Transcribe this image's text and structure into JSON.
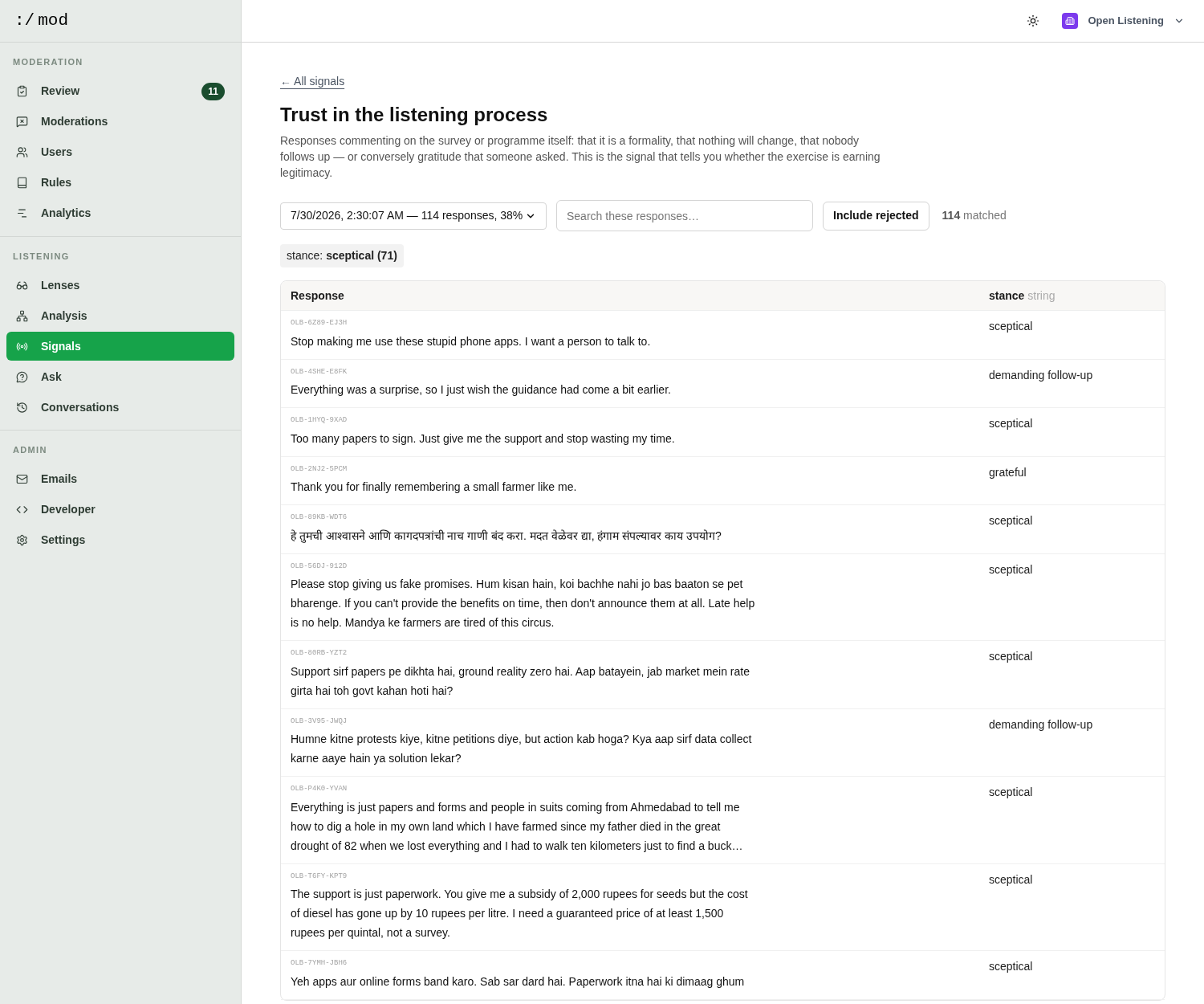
{
  "brand": {
    "mark": ":/",
    "name": "mod"
  },
  "sidebar": {
    "sections": [
      {
        "title": "MODERATION",
        "items": [
          {
            "label": "Review",
            "badge": "11",
            "selected": false
          },
          {
            "label": "Moderations",
            "selected": false
          },
          {
            "label": "Users",
            "selected": false
          },
          {
            "label": "Rules",
            "selected": false
          },
          {
            "label": "Analytics",
            "selected": false
          }
        ]
      },
      {
        "title": "LISTENING",
        "items": [
          {
            "label": "Lenses",
            "selected": false
          },
          {
            "label": "Analysis",
            "selected": false
          },
          {
            "label": "Signals",
            "selected": true
          },
          {
            "label": "Ask",
            "selected": false
          },
          {
            "label": "Conversations",
            "selected": false
          }
        ]
      },
      {
        "title": "ADMIN",
        "items": [
          {
            "label": "Emails",
            "selected": false
          },
          {
            "label": "Developer",
            "selected": false
          },
          {
            "label": "Settings",
            "selected": false
          }
        ]
      }
    ]
  },
  "topbar": {
    "workspace": "Open Listening"
  },
  "back_link": "← All signals",
  "title": "Trust in the listening process",
  "description": "Responses commenting on the survey or programme itself: that it is a formality, that nothing will change, that nobody follows up — or conversely gratitude that someone asked. This is the signal that tells you whether the exercise is earning legitimacy.",
  "filters": {
    "run_select": "7/30/2026, 2:30:07 AM — 114 responses, 38%",
    "search": {
      "placeholder": "Search these responses…"
    },
    "include_rejected": {
      "label": "Include rejected",
      "on": false
    },
    "matched_count": "114",
    "matched_label": "matched"
  },
  "active_filter": {
    "key": "stance:",
    "value": "sceptical (71)"
  },
  "table": {
    "columns": [
      {
        "label": "Response"
      },
      {
        "label": "stance",
        "type": "string"
      }
    ],
    "rows": [
      {
        "id": "OLB-6Z89-EJ3H",
        "text": "Stop making me use these stupid phone apps. I want a person to talk to.",
        "stance": "sceptical"
      },
      {
        "id": "OLB-4SHE-E8FK",
        "text": "Everything was a surprise, so I just wish the guidance had come a bit earlier.",
        "stance": "demanding follow-up"
      },
      {
        "id": "OLB-1HYQ-9XAD",
        "text": "Too many papers to sign. Just give me the support and stop wasting my time.",
        "stance": "sceptical"
      },
      {
        "id": "OLB-2NJ2-5PCM",
        "text": "Thank you for finally remembering a small farmer like me.",
        "stance": "grateful"
      },
      {
        "id": "OLB-89KB-WDT6",
        "text": "हे तुमची आश्वासने आणि कागदपत्रांची नाच गाणी बंद करा. मदत वेळेवर द्या, हंगाम संपल्यावर काय उपयोग?",
        "stance": "sceptical"
      },
      {
        "id": "OLB-56DJ-912D",
        "text": "Please stop giving us fake promises. Hum kisan hain, koi bachhe nahi jo bas baaton se pet bharenge. If you can't provide the benefits on time, then don't announce them at all. Late help is no help. Mandya ke farmers are tired of this circus.",
        "stance": "sceptical"
      },
      {
        "id": "OLB-80RB-YZT2",
        "text": "Support sirf papers pe dikhta hai, ground reality zero hai. Aap batayein, jab market mein rate girta hai toh govt kahan hoti hai?",
        "stance": "sceptical"
      },
      {
        "id": "OLB-3V95-JWQJ",
        "text": "Humne kitne protests kiye, kitne petitions diye, but action kab hoga? Kya aap sirf data collect karne aaye hain ya solution lekar?",
        "stance": "demanding follow-up"
      },
      {
        "id": "OLB-P4K0-YVAN",
        "text": "Everything is just papers and forms and people in suits coming from Ahmedabad to tell me how to dig a hole in my own land which I have farmed since my father died in the great drought of 82 when we lost everything and I had to walk ten kilometers just to find a buck…",
        "stance": "sceptical"
      },
      {
        "id": "OLB-T6FY-KPT9",
        "text": "The support is just paperwork. You give me a subsidy of 2,000 rupees for seeds but the cost of diesel has gone up by 10 rupees per litre. I need a guaranteed price of at least 1,500 rupees per quintal, not a survey.",
        "stance": "sceptical"
      },
      {
        "id": "OLB-7YMH-JBH6",
        "text": "Yeh apps aur online forms band karo. Sab sar dard hai. Paperwork itna hai ki dimaag ghum",
        "stance": "sceptical"
      }
    ]
  }
}
